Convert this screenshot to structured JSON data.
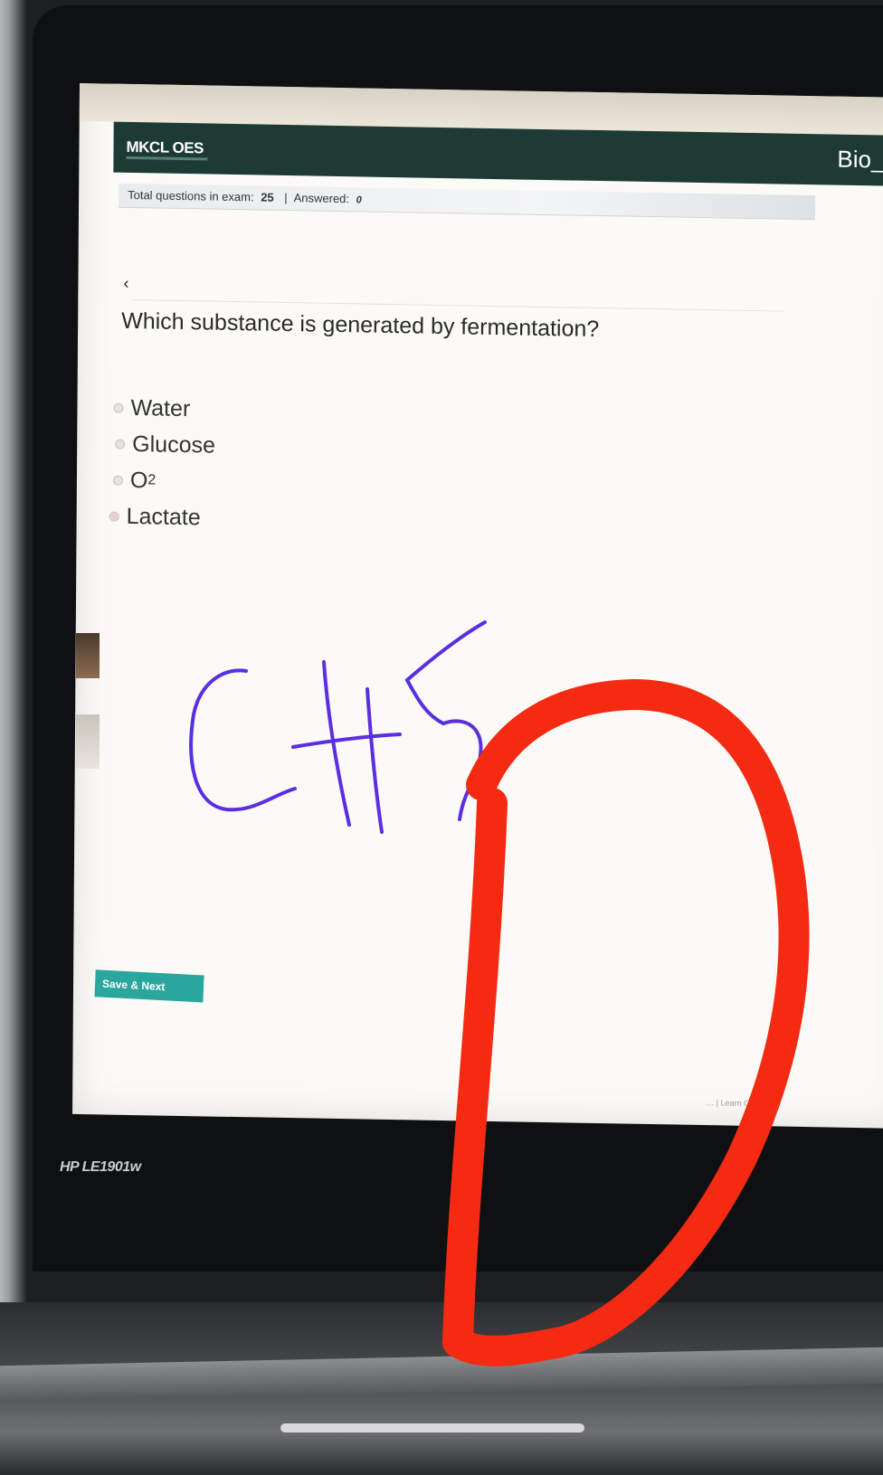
{
  "app": {
    "brand": "MKCL OES",
    "exam_title": "Bio_Q"
  },
  "status_bar": {
    "total_label": "Total questions in exam:",
    "total_value": "25",
    "separator": "|",
    "answered_label": "Answered:",
    "answered_value": "0"
  },
  "nav": {
    "previous_symbol": "‹"
  },
  "question": {
    "text": "Which substance is generated by fermentation?",
    "options": [
      {
        "label": "Water"
      },
      {
        "label": "Glucose"
      },
      {
        "label": "O",
        "subscript": "2"
      },
      {
        "label": "Lactate"
      }
    ]
  },
  "actions": {
    "save_next_label": "Save & Next"
  },
  "footer": {
    "text": "… | Learn Chart"
  },
  "monitor": {
    "model_label": "HP LE1901w"
  },
  "annotations": {
    "handwritten_text": "CH5",
    "handwritten_color": "#5b2ee0",
    "circled_letter": "D",
    "circled_color": "#f42a12"
  }
}
